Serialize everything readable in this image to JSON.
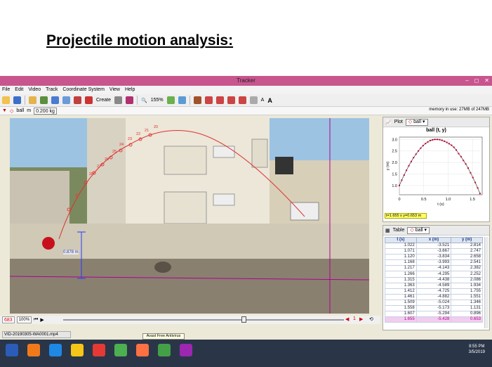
{
  "slide": {
    "title": "Projectile motion analysis:"
  },
  "window": {
    "title": "Tracker",
    "minimize": "–",
    "maximize": "◻",
    "close": "✕"
  },
  "menu": [
    "File",
    "Edit",
    "Video",
    "Track",
    "Coordinate System",
    "View",
    "Help"
  ],
  "toolbar": {
    "create_label": "Create",
    "zoom_label": "155%",
    "font_label": "A"
  },
  "trackbar": {
    "track_name": "ball",
    "mass_label": "m",
    "mass_value": "0.200 kg",
    "memory": "memory in use: 27MB of 247MB"
  },
  "video": {
    "distance_label": "0.878 m",
    "frame_labels": [
      "20",
      "21",
      "22",
      "23",
      "24",
      "25",
      "26",
      "27",
      "28"
    ]
  },
  "playback": {
    "frame": "683",
    "zoom": "100%",
    "step_number": "1"
  },
  "status": {
    "file": "VID-20190305-WA0001.mp4",
    "tooltip": "Avast Free Antivirus"
  },
  "plot": {
    "panel_label": "Plot",
    "track": "ball",
    "title": "ball (t, y)",
    "readout": "t=1.655 s  y=0.653 m"
  },
  "chart_data": {
    "type": "scatter",
    "title": "ball (t, y)",
    "xlabel": "t (s)",
    "ylabel": "y (m)",
    "xlim": [
      0,
      1.7
    ],
    "ylim": [
      0.6,
      3.1
    ],
    "x_ticks": [
      "0",
      "0.5",
      "1.0",
      "1.5"
    ],
    "y_ticks": [
      "1.0",
      "1.5",
      "2.0",
      "2.5",
      "3.0"
    ],
    "x": [
      0.0,
      0.049,
      0.097,
      0.146,
      0.195,
      0.244,
      0.292,
      0.341,
      0.39,
      0.438,
      0.487,
      0.536,
      0.584,
      0.633,
      0.682,
      0.73,
      0.779,
      0.828,
      0.876,
      0.925,
      0.974,
      1.022,
      1.071,
      1.12,
      1.168,
      1.217,
      1.266,
      1.315,
      1.363,
      1.412,
      1.461,
      1.509,
      1.558,
      1.607,
      1.655
    ],
    "y": [
      1.0,
      1.23,
      1.45,
      1.66,
      1.86,
      2.04,
      2.21,
      2.36,
      2.5,
      2.62,
      2.73,
      2.82,
      2.89,
      2.95,
      2.98,
      3.0,
      3.0,
      2.99,
      2.96,
      2.92,
      2.87,
      2.814,
      2.747,
      2.658,
      2.541,
      2.382,
      2.252,
      2.086,
      1.934,
      1.755,
      1.551,
      1.346,
      1.131,
      0.896,
      0.653
    ],
    "series_color": "#c4002c"
  },
  "table": {
    "panel_label": "Table",
    "track": "ball",
    "headers": [
      "t (s)",
      "x (m)",
      "y (m)"
    ],
    "rows": [
      [
        "1.022",
        "-3.521",
        "2.814"
      ],
      [
        "1.071",
        "-3.667",
        "2.747"
      ],
      [
        "1.120",
        "-3.834",
        "2.658"
      ],
      [
        "1.168",
        "-3.993",
        "2.541"
      ],
      [
        "1.217",
        "-4.143",
        "2.382"
      ],
      [
        "1.266",
        "-4.295",
        "2.252"
      ],
      [
        "1.315",
        "-4.438",
        "2.086"
      ],
      [
        "1.363",
        "-4.589",
        "1.934"
      ],
      [
        "1.412",
        "-4.725",
        "1.755"
      ],
      [
        "1.461",
        "-4.882",
        "1.551"
      ],
      [
        "1.509",
        "-5.024",
        "1.346"
      ],
      [
        "1.558",
        "-5.173",
        "1.131"
      ],
      [
        "1.607",
        "-5.294",
        "0.896"
      ],
      [
        "1.655",
        "-5.428",
        "0.653"
      ]
    ],
    "selected_row": 13
  },
  "taskbar": {
    "time": "8:55 PM",
    "date": "3/5/2019",
    "app_colors": [
      "#2b5cb8",
      "#f07a1a",
      "#1e88e5",
      "#f5c518",
      "#e53935",
      "#4caf50",
      "#ff7043",
      "#43a047",
      "#9c27b0"
    ]
  },
  "colors": {
    "title_bar": "#c8558e",
    "track_line": "#b00090",
    "trail": "#e04040",
    "ball": "#c8101c"
  }
}
